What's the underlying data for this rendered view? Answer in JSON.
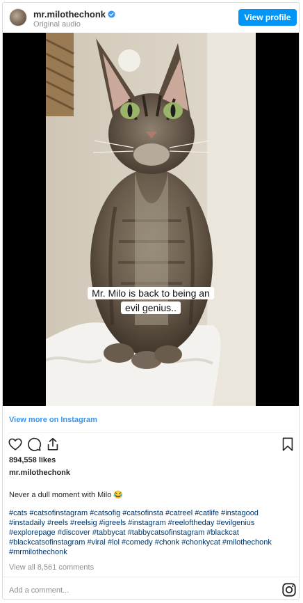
{
  "post": {
    "username": "mr.milothechonk",
    "audio": "Original audio",
    "view_profile_label": "View profile",
    "video_caption_line1": "Mr. Milo is back to being an",
    "video_caption_line2": "evil genius..",
    "view_more_label": "View more on Instagram",
    "likes": "894,558 likes",
    "owner": "mr.milothechonk",
    "message": "Never a dull moment with Milo 😂",
    "hashtags": "#cats #catsofinstagram #catsofig #catsofinsta #catreel #catlife #instagood #instadaily #reels #reelsig #igreels #instagram #reeloftheday #evilgenius #explorepage #discover #tabbycat #tabbycatsofinstagram #blackcat #blackcatsofinstagram #viral #lol #comedy #chonk #chonkycat #milothechonk #mrmilothechonk",
    "view_comments": "View all 8,561 comments",
    "add_comment_placeholder": "Add a comment..."
  },
  "colors": {
    "accent": "#0095f6",
    "link_blue": "#3897f0",
    "hashtag": "#00376b",
    "muted": "#8e8e8e"
  },
  "icons": [
    "verified-badge-icon",
    "heart-icon",
    "comment-icon",
    "share-icon",
    "bookmark-icon",
    "instagram-icon"
  ]
}
